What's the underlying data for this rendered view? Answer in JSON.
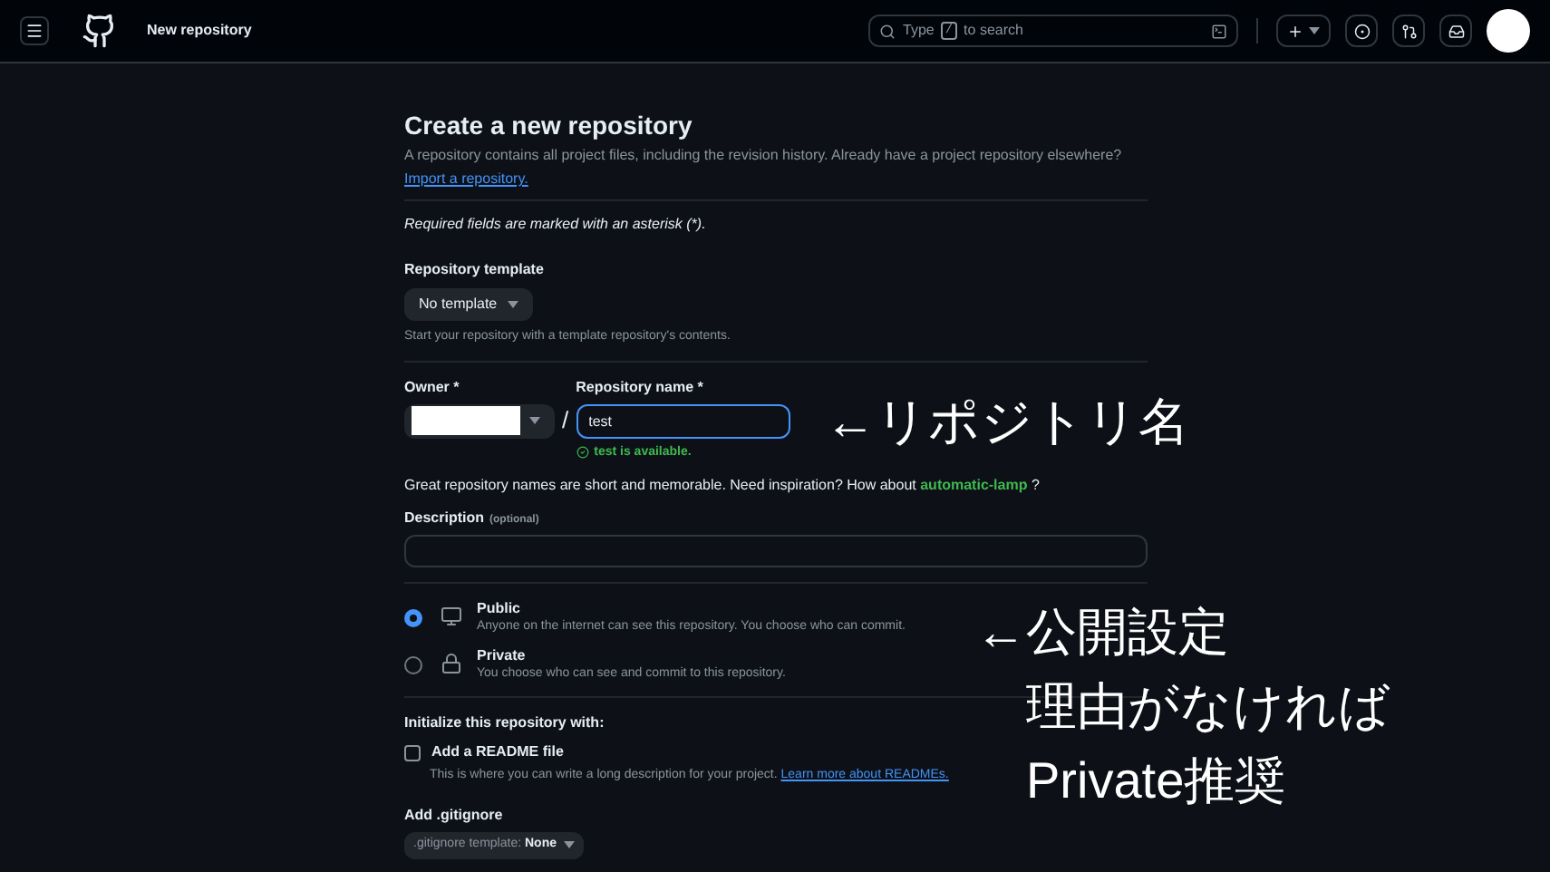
{
  "header": {
    "title": "New repository",
    "search": {
      "prefix": "Type",
      "key": "/",
      "suffix": "to search"
    }
  },
  "form": {
    "heading": "Create a new repository",
    "intro": "A repository contains all project files, including the revision history. Already have a project repository elsewhere?",
    "import_link": "Import a repository.",
    "required_note": "Required fields are marked with an asterisk (*).",
    "template": {
      "label": "Repository template",
      "value": "No template",
      "hint": "Start your repository with a template repository's contents."
    },
    "owner": {
      "label": "Owner *"
    },
    "separator": "/",
    "repo_name": {
      "label": "Repository name *",
      "value": "test",
      "status": "test is available."
    },
    "suggestion": {
      "text": "Great repository names are short and memorable. Need inspiration? How about",
      "name": "automatic-lamp",
      "suffix": "?"
    },
    "description": {
      "label": "Description",
      "optional": "(optional)"
    },
    "visibility": [
      {
        "kind": "public",
        "label": "Public",
        "description": "Anyone on the internet can see this repository. You choose who can commit.",
        "selected": true
      },
      {
        "kind": "private",
        "label": "Private",
        "description": "You choose who can see and commit to this repository.",
        "selected": false
      }
    ],
    "init": {
      "heading": "Initialize this repository with:",
      "readme": {
        "label": "Add a README file",
        "checked": false,
        "hint": "This is where you can write a long description for your project.",
        "link": "Learn more about READMEs."
      }
    },
    "gitignore": {
      "heading": "Add .gitignore",
      "prefix": ".gitignore template:",
      "value": "None"
    }
  },
  "annotations": [
    {
      "lines": [
        "←リポジトリ名"
      ]
    },
    {
      "lines": [
        "←公開設定",
        "理由がなければ",
        "Private推奨"
      ]
    }
  ]
}
